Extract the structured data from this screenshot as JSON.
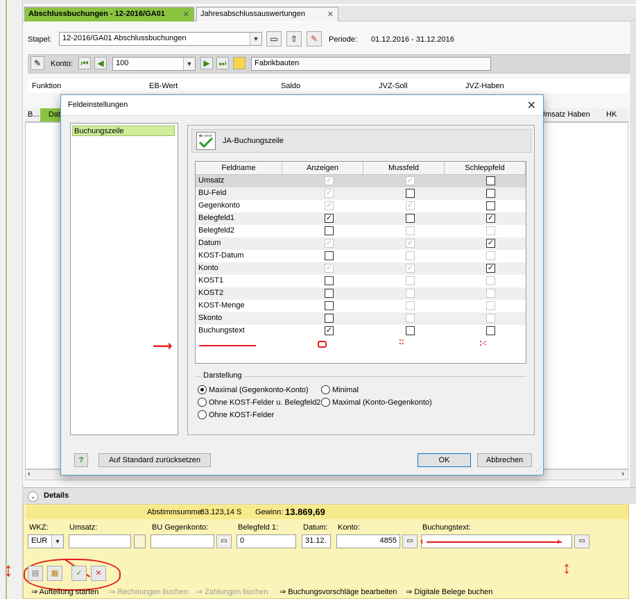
{
  "tabs": [
    {
      "label": "Abschlussbuchungen - 12-2016/GA01",
      "close": "✕"
    },
    {
      "label": "Jahresabschlussauswertungen",
      "close": "✕"
    }
  ],
  "stapel": {
    "label": "Stapel:",
    "value": "12-2016/GA01  Abschlussbuchungen",
    "periode_label": "Periode:",
    "periode_value": "01.12.2016 - 31.12.2016"
  },
  "konto": {
    "label": "Konto:",
    "value": "100",
    "name": "Fabrikbauten"
  },
  "columns": {
    "funktion": "Funktion",
    "eb_wert": "EB-Wert",
    "saldo": "Saldo",
    "jvz_soll": "JVZ-Soll",
    "jvz_haben": "JVZ-Haben"
  },
  "grid_headers": {
    "b": "B...",
    "dat": "Dat",
    "umsatz_haben": "Umsatz Haben",
    "hk": "HK"
  },
  "dialog": {
    "title": "Feldeinstellungen",
    "close": "✕",
    "tree_item": "Buchungszeile",
    "section_title": "JA-Buchungszeile",
    "table_headers": [
      "Feldname",
      "Anzeigen",
      "Mussfeld",
      "Schleppfeld"
    ],
    "rows": [
      {
        "name": "Umsatz",
        "anzeigen": "checked-disabled",
        "muss": "checked-disabled",
        "schlepp": "unchecked"
      },
      {
        "name": "BU-Feld",
        "anzeigen": "checked-disabled",
        "muss": "unchecked",
        "schlepp": "unchecked"
      },
      {
        "name": "Gegenkonto",
        "anzeigen": "checked-disabled",
        "muss": "checked-disabled",
        "schlepp": "unchecked"
      },
      {
        "name": "Belegfeld1",
        "anzeigen": "checked",
        "muss": "unchecked",
        "schlepp": "checked"
      },
      {
        "name": "Belegfeld2",
        "anzeigen": "unchecked",
        "muss": "disabled",
        "schlepp": "disabled"
      },
      {
        "name": "Datum",
        "anzeigen": "checked-disabled",
        "muss": "checked-disabled",
        "schlepp": "checked"
      },
      {
        "name": "KOST-Datum",
        "anzeigen": "unchecked",
        "muss": "disabled",
        "schlepp": "disabled"
      },
      {
        "name": "Konto",
        "anzeigen": "checked-disabled",
        "muss": "checked-disabled",
        "schlepp": "checked"
      },
      {
        "name": "KOST1",
        "anzeigen": "unchecked",
        "muss": "disabled",
        "schlepp": "disabled"
      },
      {
        "name": "KOST2",
        "anzeigen": "unchecked",
        "muss": "disabled",
        "schlepp": "disabled"
      },
      {
        "name": "KOST-Menge",
        "anzeigen": "unchecked",
        "muss": "disabled",
        "schlepp": "disabled"
      },
      {
        "name": "Skonto",
        "anzeigen": "unchecked",
        "muss": "disabled",
        "schlepp": "disabled"
      },
      {
        "name": "Buchungstext",
        "anzeigen": "checked",
        "muss": "unchecked",
        "schlepp": "unchecked"
      }
    ],
    "darstellung": {
      "title": "Darstellung",
      "options": [
        {
          "label": "Maximal (Gegenkonto-Konto)",
          "selected": true
        },
        {
          "label": "Minimal",
          "selected": false
        },
        {
          "label": "Ohne KOST-Felder u. Belegfeld2",
          "selected": false
        },
        {
          "label": "Maximal (Konto-Gegenkonto)",
          "selected": false
        },
        {
          "label": "Ohne KOST-Felder",
          "selected": false
        }
      ]
    },
    "help": "?",
    "reset": "Auf Standard zurücksetzen",
    "ok": "OK",
    "cancel": "Abbrechen"
  },
  "details": {
    "title": "Details",
    "abstimmsumme_label": "Abstimmsumme:",
    "abstimmsumme_value": "63.123,14 S",
    "gewinn_label": "Gewinn:",
    "gewinn_value": "13.869,69",
    "wkz_label": "WKZ:",
    "wkz_value": "EUR",
    "umsatz_label": "Umsatz:",
    "umsatz_value": "",
    "bu_label": "BU Gegenkonto:",
    "bu_value": "",
    "beleg_label": "Belegfeld 1:",
    "beleg_value": "0",
    "datum_label": "Datum:",
    "datum_value": "31.12.",
    "konto_label": "Konto:",
    "konto_value": "4855",
    "text_label": "Buchungstext:",
    "text_value": ""
  },
  "actions": [
    {
      "label": "Aufteilung starten",
      "enabled": true
    },
    {
      "label": "Rechnungen buchen",
      "enabled": false
    },
    {
      "label": "Zahlungen buchen",
      "enabled": false
    },
    {
      "label": "Buchungsvorschläge bearbeiten",
      "enabled": true
    },
    {
      "label": "Digitale Belege buchen",
      "enabled": true
    }
  ],
  "colors": {
    "tab_active": "#8ac440",
    "tree_selected": "#d0ee9c",
    "details_bg": "#fbf4b8",
    "annotation": "#e21a1a"
  }
}
